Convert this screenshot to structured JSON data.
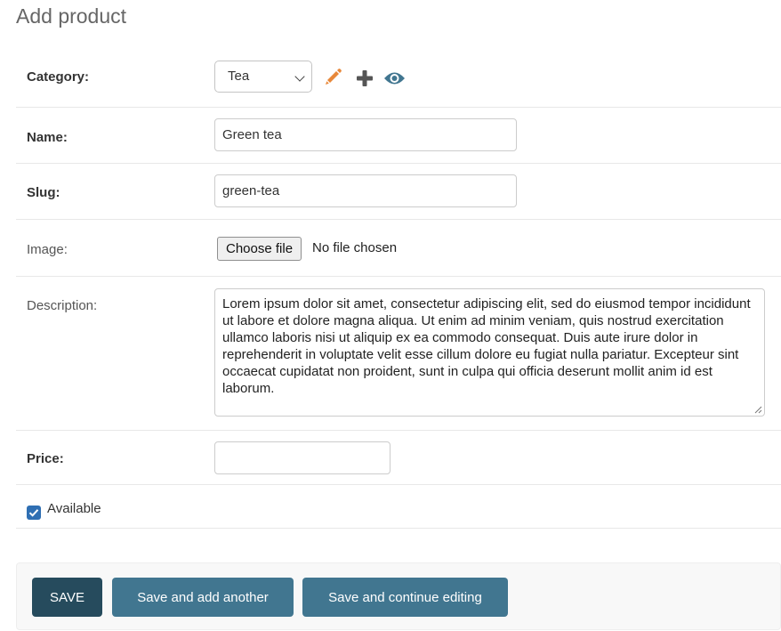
{
  "page": {
    "title": "Add product"
  },
  "fields": {
    "category": {
      "label": "Category:",
      "value": "Tea"
    },
    "name": {
      "label": "Name:",
      "value": "Green tea"
    },
    "slug": {
      "label": "Slug:",
      "value": "green-tea"
    },
    "image": {
      "label": "Image:",
      "button_label": "Choose file",
      "status": "No file chosen"
    },
    "description": {
      "label": "Description:",
      "value": "Lorem ipsum dolor sit amet, consectetur adipiscing elit, sed do eiusmod tempor incididunt ut labore et dolore magna aliqua. Ut enim ad minim veniam, quis nostrud exercitation ullamco laboris nisi ut aliquip ex ea commodo consequat. Duis aute irure dolor in reprehenderit in voluptate velit esse cillum dolore eu fugiat nulla pariatur. Excepteur sint occaecat cupidatat non proident, sunt in culpa qui officia deserunt mollit anim id est laborum."
    },
    "price": {
      "label": "Price:",
      "value": ""
    },
    "available": {
      "label": "Available",
      "checked": true
    }
  },
  "icons": {
    "edit": "pencil-icon",
    "add": "plus-icon",
    "view": "eye-icon"
  },
  "colors": {
    "primary_button": "#417690",
    "save_button": "#264b5d",
    "edit_icon": "#e8883a",
    "checkbox": "#2f6fb3"
  },
  "actions": {
    "save": "SAVE",
    "save_add_another": "Save and add another",
    "save_continue": "Save and continue editing"
  }
}
